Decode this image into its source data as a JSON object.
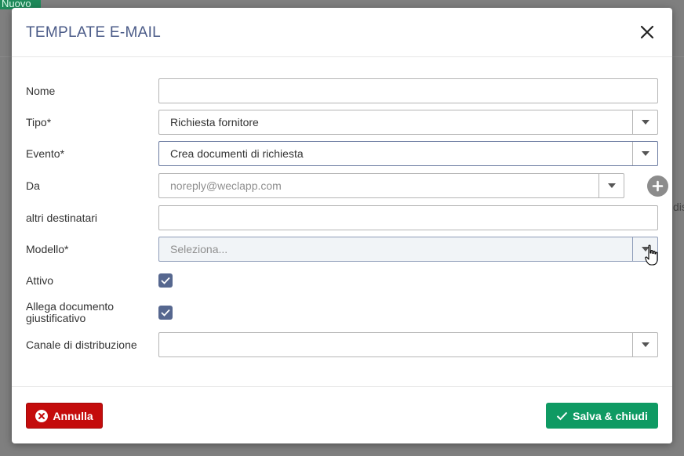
{
  "background": {
    "new_button": "Nuovo",
    "side_text": "dis"
  },
  "dialog": {
    "title": "TEMPLATE E-MAIL",
    "close_icon": "close-icon"
  },
  "form": {
    "nome": {
      "label": "Nome",
      "value": ""
    },
    "tipo": {
      "label": "Tipo*",
      "value": "Richiesta fornitore"
    },
    "evento": {
      "label": "Evento*",
      "value": "Crea documenti di richiesta"
    },
    "da": {
      "label": "Da",
      "placeholder": "noreply@weclapp.com",
      "add_icon": "plus-circle-icon"
    },
    "altri": {
      "label": "altri destinatari",
      "value": ""
    },
    "modello": {
      "label": "Modello*",
      "placeholder": "Seleziona..."
    },
    "attivo": {
      "label": "Attivo",
      "checked": true
    },
    "allega": {
      "label": "Allega documento giustificativo",
      "checked": true
    },
    "canale": {
      "label": "Canale di distribuzione",
      "value": ""
    }
  },
  "footer": {
    "cancel_label": "Annulla",
    "save_label": "Salva & chiudi"
  },
  "colors": {
    "title": "#4a5a87",
    "checkbox": "#56678f",
    "cancel": "#c40c0c",
    "save": "#0f9a63"
  }
}
